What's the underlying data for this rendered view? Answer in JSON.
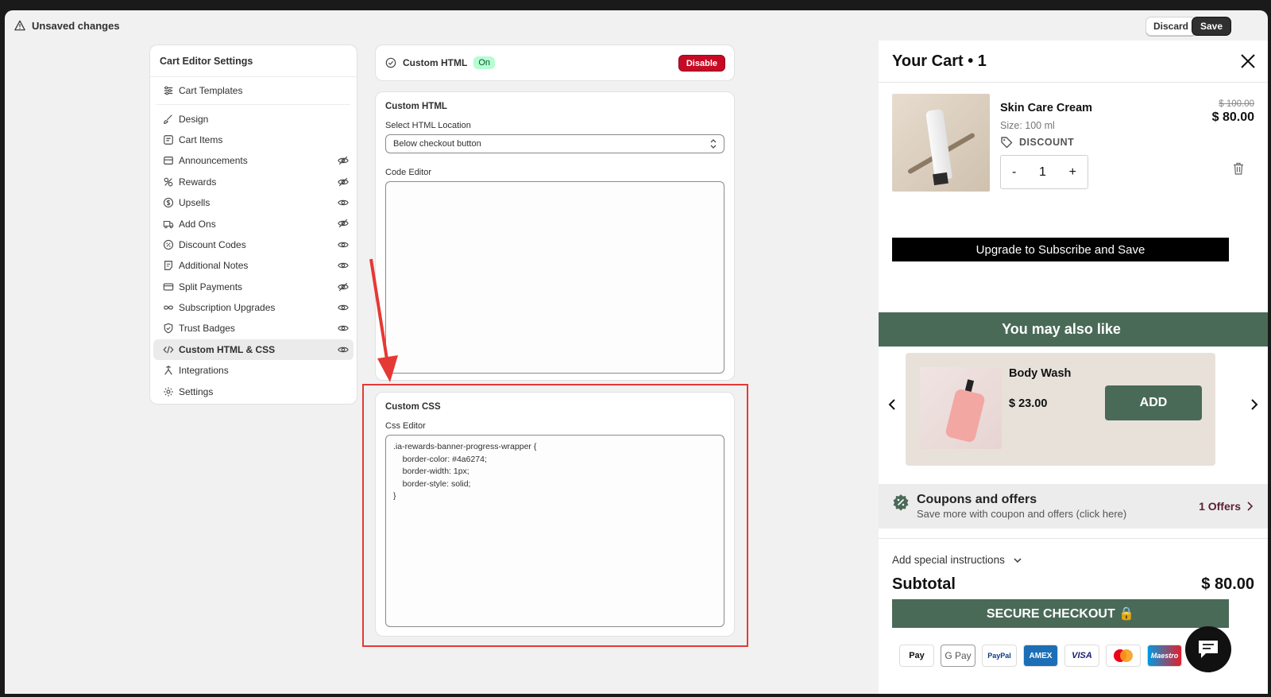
{
  "topbar": {
    "title": "Unsaved changes",
    "discard_label": "Discard",
    "save_label": "Save"
  },
  "settings": {
    "title": "Cart Editor Settings",
    "items": [
      {
        "label": "Cart Templates",
        "icon": "sliders-icon",
        "visibility": null
      },
      {
        "label": "Design",
        "icon": "brush-icon",
        "visibility": null
      },
      {
        "label": "Cart Items",
        "icon": "cart-items-icon",
        "visibility": null
      },
      {
        "label": "Announcements",
        "icon": "announcement-icon",
        "visibility": "hidden"
      },
      {
        "label": "Rewards",
        "icon": "rewards-icon",
        "visibility": "hidden"
      },
      {
        "label": "Upsells",
        "icon": "dollar-icon",
        "visibility": "visible"
      },
      {
        "label": "Add Ons",
        "icon": "truck-icon",
        "visibility": "hidden"
      },
      {
        "label": "Discount Codes",
        "icon": "discount-icon",
        "visibility": "visible"
      },
      {
        "label": "Additional Notes",
        "icon": "note-icon",
        "visibility": "visible"
      },
      {
        "label": "Split Payments",
        "icon": "card-icon",
        "visibility": "hidden"
      },
      {
        "label": "Subscription Upgrades",
        "icon": "infinity-icon",
        "visibility": "visible"
      },
      {
        "label": "Trust Badges",
        "icon": "shield-icon",
        "visibility": "visible"
      },
      {
        "label": "Custom HTML & CSS",
        "icon": "code-icon",
        "visibility": "visible",
        "active": true
      },
      {
        "label": "Integrations",
        "icon": "integration-icon",
        "visibility": null
      },
      {
        "label": "Settings",
        "icon": "gear-icon",
        "visibility": null
      }
    ]
  },
  "status_card": {
    "label": "Custom HTML",
    "badge": "On",
    "disable_label": "Disable"
  },
  "html_card": {
    "title": "Custom HTML",
    "location_label": "Select HTML Location",
    "location_value": "Below checkout button",
    "code_editor_label": "Code Editor",
    "code_editor_value": ""
  },
  "css_card": {
    "title": "Custom CSS",
    "editor_label": "Css Editor",
    "editor_value": ".ia-rewards-banner-progress-wrapper {\n    border-color: #4a6274;\n    border-width: 1px;\n    border-style: solid;\n}"
  },
  "cart": {
    "title": "Your Cart • 1",
    "product": {
      "name": "Skin Care Cream",
      "size": "Size: 100 ml",
      "discount_label": "DISCOUNT",
      "old_price": "$ 100.00",
      "price": "$ 80.00",
      "quantity": "1",
      "minus": "-",
      "plus": "+"
    },
    "upgrade_label": "Upgrade to Subscribe and Save",
    "also_like_title": "You may also like",
    "recommendation": {
      "name": "Body Wash",
      "price": "$ 23.00",
      "add_label": "ADD"
    },
    "coupons": {
      "title": "Coupons and offers",
      "subtitle": "Save more with coupon and offers (click here)",
      "offers_label": "1 Offers"
    },
    "instructions_label": "Add special instructions",
    "subtotal_label": "Subtotal",
    "subtotal_value": "$ 80.00",
    "checkout_label": "SECURE CHECKOUT 🔒",
    "payments": [
      "Pay",
      "G Pay",
      "PayPal",
      "AMEX",
      "VISA",
      "",
      "Maestro"
    ]
  },
  "colors": {
    "accent_green": "#4a6a58",
    "danger_red": "#c70a24",
    "highlight_red": "#e53935",
    "badge_green": "#b4fed2"
  }
}
